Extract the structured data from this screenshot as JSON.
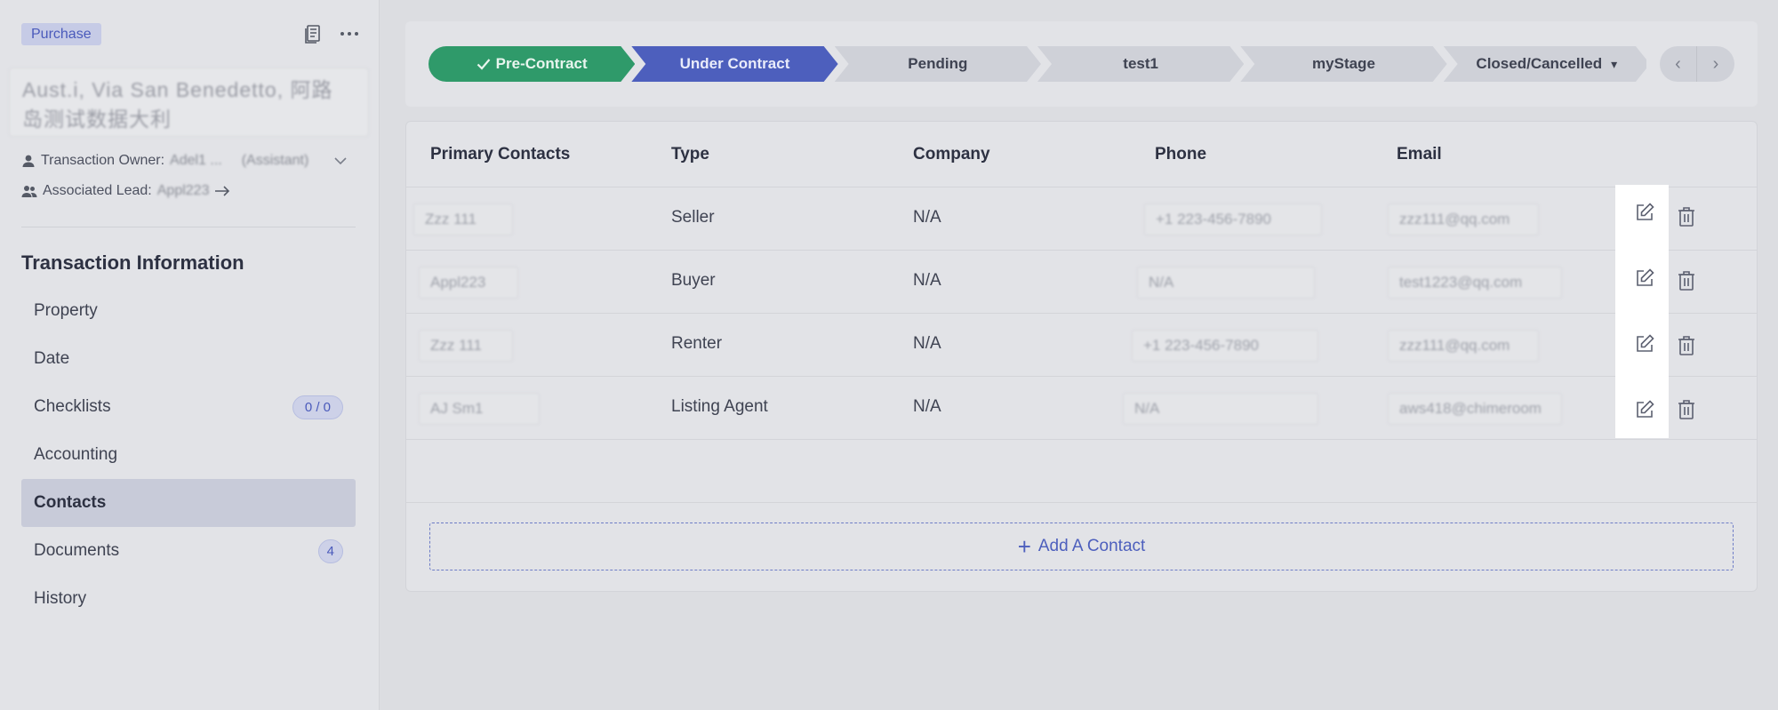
{
  "sidebar": {
    "tag": "Purchase",
    "title": "Aust.i, Via San Benedetto, 阿路\n岛测试数据大利",
    "owner_label": "Transaction Owner:",
    "owner_value": "Adel1 ...",
    "owner_role": "(Assistant)",
    "lead_label": "Associated Lead:",
    "lead_value": "Appl223",
    "section_title": "Transaction Information",
    "items": [
      {
        "label": "Property"
      },
      {
        "label": "Date"
      },
      {
        "label": "Checklists",
        "badge": "0 / 0"
      },
      {
        "label": "Accounting"
      },
      {
        "label": "Contacts"
      },
      {
        "label": "Documents",
        "badge": "4"
      },
      {
        "label": "History"
      }
    ]
  },
  "stages": [
    {
      "label": "Pre-Contract"
    },
    {
      "label": "Under Contract"
    },
    {
      "label": "Pending"
    },
    {
      "label": "test1"
    },
    {
      "label": "myStage"
    },
    {
      "label": "Closed/Cancelled"
    }
  ],
  "table": {
    "headers": [
      "Primary Contacts",
      "Type",
      "Company",
      "Phone",
      "Email"
    ],
    "rows": [
      {
        "contact": "Zzz 111",
        "type": "Seller",
        "company": "N/A",
        "phone": "+1 223-456-7890",
        "email": "zzz111@qq.com"
      },
      {
        "contact": "Appl223",
        "type": "Buyer",
        "company": "N/A",
        "phone": "N/A",
        "email": "test1223@qq.com"
      },
      {
        "contact": "Zzz 111",
        "type": "Renter",
        "company": "N/A",
        "phone": "+1 223-456-7890",
        "email": "zzz111@qq.com"
      },
      {
        "contact": "AJ Sm1",
        "type": "Listing Agent",
        "company": "N/A",
        "phone": "N/A",
        "email": "aws418@chimeroom"
      }
    ],
    "add_label": "Add A Contact"
  }
}
